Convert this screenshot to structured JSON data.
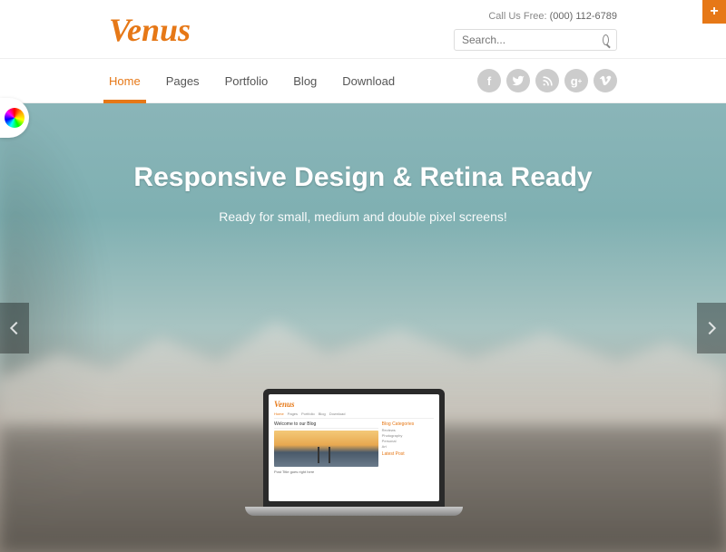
{
  "header": {
    "logo": "Venus",
    "call_label": "Call Us Free: ",
    "phone": "(000) 112-6789",
    "search_placeholder": "Search..."
  },
  "nav": {
    "items": [
      {
        "label": "Home",
        "active": true
      },
      {
        "label": "Pages",
        "active": false
      },
      {
        "label": "Portfolio",
        "active": false
      },
      {
        "label": "Blog",
        "active": false
      },
      {
        "label": "Download",
        "active": false
      }
    ],
    "social": [
      "facebook",
      "twitter",
      "rss",
      "google-plus",
      "vimeo"
    ]
  },
  "hero": {
    "title": "Responsive Design & Retina Ready",
    "subtitle": "Ready for small, medium and double pixel screens!"
  },
  "laptop_preview": {
    "logo": "Venus",
    "nav": [
      "Home",
      "Pages",
      "Portfolio",
      "Blog",
      "Download"
    ],
    "page_title": "Welcome to our Blog",
    "sidebar_heading1": "Blog Categories",
    "sidebar_items": [
      "Reviews",
      "Photography",
      "Personal",
      "Art"
    ],
    "sidebar_heading2": "Latest Post",
    "post_title": "Post Title goes right here"
  },
  "colors": {
    "accent": "#e67817"
  },
  "corner_badge": "+"
}
